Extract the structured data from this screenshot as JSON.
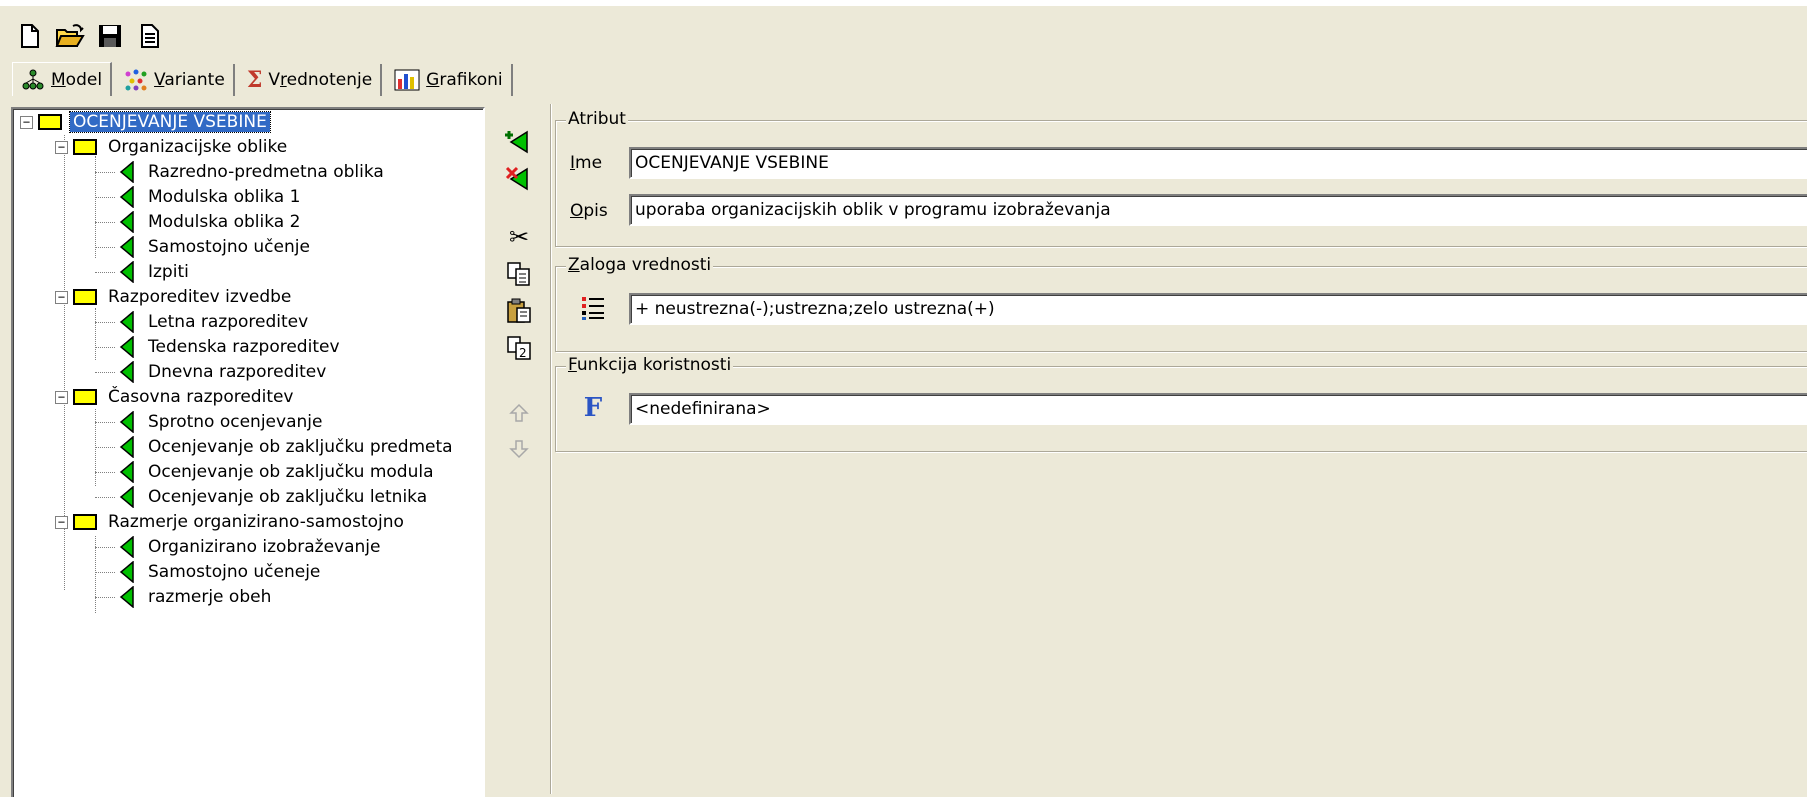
{
  "toolbar": {
    "buttons": [
      {
        "name": "new-file-button",
        "icon": "new-file-icon"
      },
      {
        "name": "open-folder-button",
        "icon": "open-folder-icon"
      },
      {
        "name": "save-button",
        "icon": "floppy-disk-icon"
      },
      {
        "name": "properties-button",
        "icon": "document-icon"
      }
    ]
  },
  "tabs": [
    {
      "label": "Model",
      "icon": "model-tree-icon",
      "active": true
    },
    {
      "label": "Variante",
      "icon": "variants-dots-icon",
      "active": false
    },
    {
      "label": "Vrednotenje",
      "icon": "sigma-icon",
      "active": false
    },
    {
      "label": "Grafikoni",
      "icon": "bar-chart-icon",
      "active": false
    }
  ],
  "tree": {
    "root": "OCENJEVANJE VSEBINE",
    "groups": [
      {
        "label": "Organizacijske oblike",
        "children": [
          "Razredno-predmetna oblika",
          "Modulska oblika 1",
          "Modulska oblika 2",
          "Samostojno učenje",
          "Izpiti"
        ]
      },
      {
        "label": "Razporeditev izvedbe",
        "children": [
          "Letna razporeditev",
          "Tedenska razporeditev",
          "Dnevna razporeditev"
        ]
      },
      {
        "label": "Časovna razporeditev",
        "children": [
          "Sprotno ocenjevanje",
          "Ocenjevanje ob zaključku predmeta",
          "Ocenjevanje ob zaključku modula",
          "Ocenjevanje ob zaključku letnika"
        ]
      },
      {
        "label": "Razmerje organizirano-samostojno",
        "children": [
          "Organizirano izobraževanje",
          "Samostojno učeneje",
          "razmerje obeh"
        ]
      }
    ]
  },
  "side_tools": [
    "add-attribute-icon",
    "delete-attribute-icon",
    "cut-icon",
    "copy-icon",
    "paste-icon",
    "paste-special-icon",
    "move-up-icon",
    "move-down-icon"
  ],
  "atribut": {
    "title": "Atribut",
    "ime_label_u": "I",
    "ime_label_rest": "me",
    "ime_value": "OCENJEVANJE VSEBINE",
    "opis_label_u": "O",
    "opis_label_rest": "pis",
    "opis_value": "uporaba organizacijskih oblik v programu izobraževanja"
  },
  "zaloga": {
    "title_u": "Z",
    "title_rest": "aloga vrednosti",
    "value": "+ neustrezna(-);ustrezna;zelo ustrezna(+)"
  },
  "funkcija": {
    "title_u": "F",
    "title_rest": "unkcija koristnosti",
    "icon_text": "F",
    "value": "<nedefinirana>"
  }
}
